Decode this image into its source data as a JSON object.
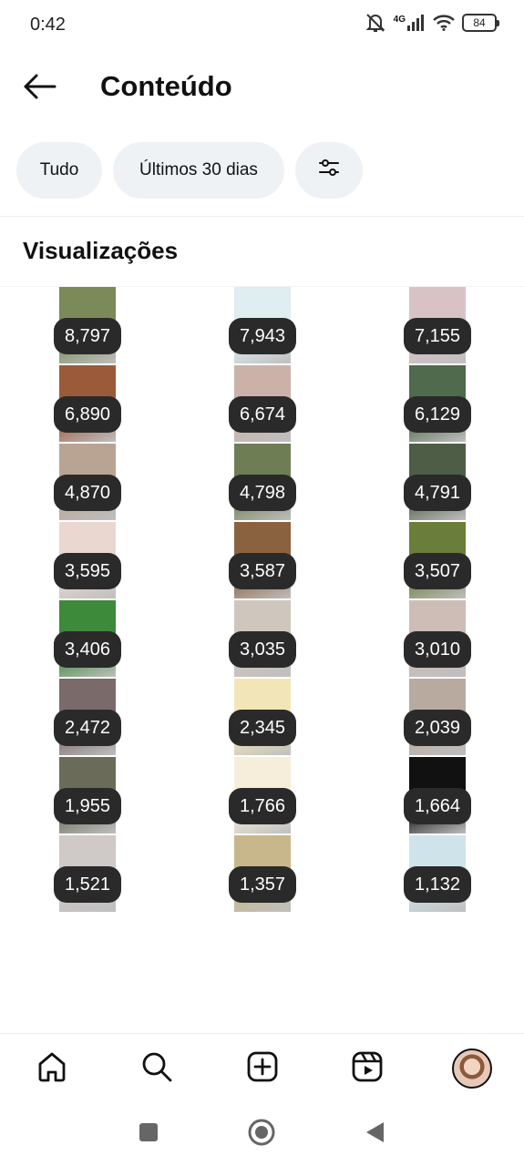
{
  "status_bar": {
    "time": "0:42",
    "network": "4G",
    "battery": "84"
  },
  "header": {
    "title": "Conteúdo",
    "back_icon": "arrow-left-icon"
  },
  "filters": {
    "all_label": "Tudo",
    "period_label": "Últimos 30 dias",
    "filter_icon": "sliders-icon"
  },
  "section": {
    "title": "Visualizações"
  },
  "posts": [
    {
      "views": "8,797",
      "thumb": "#7c8a5a"
    },
    {
      "views": "7,943",
      "thumb": "#dfeef0"
    },
    {
      "views": "7,155",
      "thumb": "#d9c2c6"
    },
    {
      "views": "6,890",
      "thumb": "#9b5a3a"
    },
    {
      "views": "6,674",
      "thumb": "#cbb2a8"
    },
    {
      "views": "6,129",
      "thumb": "#4f6a4c"
    },
    {
      "views": "4,870",
      "thumb": "#b9a494"
    },
    {
      "views": "4,798",
      "thumb": "#6f7d55"
    },
    {
      "views": "4,791",
      "thumb": "#4e5e46"
    },
    {
      "views": "3,595",
      "thumb": "#e9d7d0"
    },
    {
      "views": "3,587",
      "thumb": "#8a6240"
    },
    {
      "views": "3,507",
      "thumb": "#6a7d3a"
    },
    {
      "views": "3,406",
      "thumb": "#3d8a3a"
    },
    {
      "views": "3,035",
      "thumb": "#cfc6bd"
    },
    {
      "views": "3,010",
      "thumb": "#cdbdb6"
    },
    {
      "views": "2,472",
      "thumb": "#7a6a6a"
    },
    {
      "views": "2,345",
      "thumb": "#f2e6b8"
    },
    {
      "views": "2,039",
      "thumb": "#b9aaa0"
    },
    {
      "views": "1,955",
      "thumb": "#6b6b5a"
    },
    {
      "views": "1,766",
      "thumb": "#f6eedb"
    },
    {
      "views": "1,664",
      "thumb": "#111111"
    },
    {
      "views": "1,521",
      "thumb": "#cfc9c7"
    },
    {
      "views": "1,357",
      "thumb": "#c8b78a"
    },
    {
      "views": "1,132",
      "thumb": "#cfe3ea"
    }
  ],
  "bottom_nav": {
    "home_icon": "home-icon",
    "search_icon": "search-icon",
    "create_icon": "plus-square-icon",
    "reels_icon": "reels-icon",
    "profile_icon": "avatar"
  }
}
